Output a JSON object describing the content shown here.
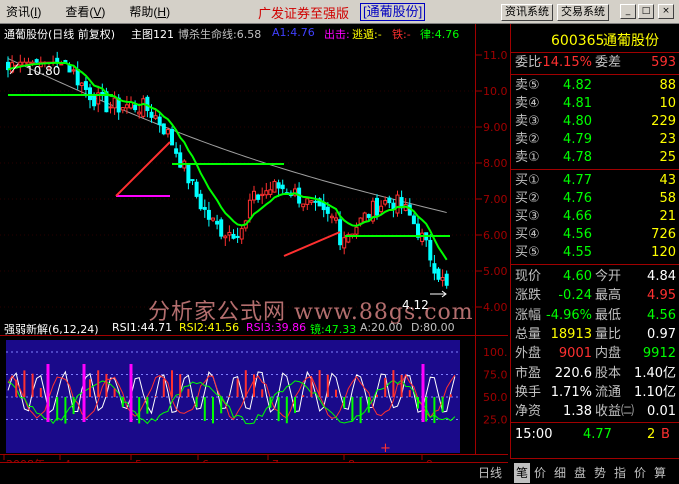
{
  "menu": {
    "items": [
      {
        "label": "资讯",
        "key": "I"
      },
      {
        "label": "查看",
        "key": "V"
      },
      {
        "label": "帮助",
        "key": "H"
      }
    ],
    "app_title": "广发证券至强版",
    "stock_title": "[通葡股份]",
    "btn_info": "资讯系统",
    "btn_trade": "交易系统",
    "win_min": "_",
    "win_max": "□",
    "win_close": "×"
  },
  "main_chart": {
    "stock_name": "通葡股份(日线 前复权)",
    "main_label": "主图121",
    "ind_name": "博杀生命线:6.58",
    "a1": "A1:4.76",
    "exit": "出击:",
    "escape": "逃遁:-",
    "iron": "铁:-",
    "law": "律:4.76",
    "high_mark": "10.80",
    "low_mark": "4.12",
    "y_ticks": [
      "11.00",
      "10.00",
      "9.00",
      "8.00",
      "7.00",
      "6.00",
      "5.00",
      "4.00"
    ],
    "date_labels": [
      "2008年",
      "4",
      "5",
      "6",
      "7",
      "8",
      "9"
    ],
    "watermark": "分析家公式网 www.88gs.com"
  },
  "sub_chart": {
    "name": "强弱新解(6,12,24)",
    "rsi1": "RSI1:44.71",
    "rsi2": "RSI2:41.56",
    "rsi3": "RSI3:39.86",
    "mirror": "镜:47.33",
    "a": "A:20.00",
    "d": "D:80.00",
    "y_ticks": [
      "100.00",
      "75.00",
      "50.00",
      "25.00"
    ]
  },
  "bottom_tabs": {
    "period": "日线",
    "tabs": [
      "笔",
      "价",
      "细",
      "盘",
      "势",
      "指",
      "价",
      "算"
    ]
  },
  "quote_panel": {
    "code": "600365",
    "name": "通葡股份",
    "ratio_label": "委比",
    "ratio_value": "-14.15%",
    "diff_label": "委差",
    "diff_value": "593",
    "asks": [
      {
        "label": "卖⑤",
        "price": "4.82",
        "vol": "88"
      },
      {
        "label": "卖④",
        "price": "4.81",
        "vol": "10"
      },
      {
        "label": "卖③",
        "price": "4.80",
        "vol": "229"
      },
      {
        "label": "卖②",
        "price": "4.79",
        "vol": "23"
      },
      {
        "label": "卖①",
        "price": "4.78",
        "vol": "25"
      }
    ],
    "bids": [
      {
        "label": "买①",
        "price": "4.77",
        "vol": "43"
      },
      {
        "label": "买②",
        "price": "4.76",
        "vol": "58"
      },
      {
        "label": "买③",
        "price": "4.66",
        "vol": "21"
      },
      {
        "label": "买④",
        "price": "4.56",
        "vol": "726"
      },
      {
        "label": "买⑤",
        "price": "4.55",
        "vol": "120"
      }
    ],
    "stats": [
      {
        "l1": "现价",
        "v1": "4.60",
        "c1": "#00ff00",
        "l2": "今开",
        "v2": "4.84",
        "c2": "#ffffff"
      },
      {
        "l1": "涨跌",
        "v1": "-0.24",
        "c1": "#00ff00",
        "l2": "最高",
        "v2": "4.95",
        "c2": "#ff3030"
      },
      {
        "l1": "涨幅",
        "v1": "-4.96%",
        "c1": "#00ff00",
        "l2": "最低",
        "v2": "4.56",
        "c2": "#00ff00"
      },
      {
        "l1": "总量",
        "v1": "18913",
        "c1": "#ffff00",
        "l2": "量比",
        "v2": "0.97",
        "c2": "#ffffff"
      },
      {
        "l1": "外盘",
        "v1": "9001",
        "c1": "#ff3030",
        "l2": "内盘",
        "v2": "9912",
        "c2": "#00ff00"
      },
      {
        "l1": "市盈",
        "v1": "220.6",
        "c1": "#ffffff",
        "l2": "股本",
        "v2": "1.40亿",
        "c2": "#ffffff"
      },
      {
        "l1": "换手",
        "v1": "1.71%",
        "c1": "#ffffff",
        "l2": "流通",
        "v2": "1.10亿",
        "c2": "#ffffff"
      },
      {
        "l1": "净资",
        "v1": "1.38",
        "c1": "#ffffff",
        "l2": "收益㈡",
        "v2": "0.01",
        "c2": "#ffffff"
      }
    ],
    "tick": {
      "time": "15:00",
      "price": "4.77",
      "vol": "2",
      "side": "B"
    }
  },
  "colors": {
    "up": "#ff3030",
    "down": "#00ff00",
    "neutral": "#ffffff",
    "frame": "#a00000",
    "sub_bg": "#1a0a8a"
  }
}
